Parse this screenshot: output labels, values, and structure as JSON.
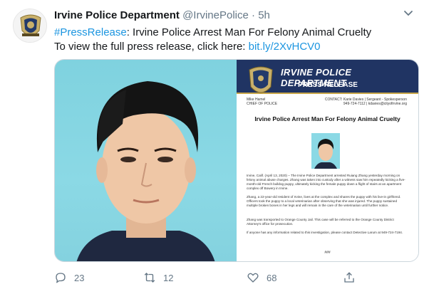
{
  "tweet": {
    "author_name": "Irvine Police Department",
    "author_handle": "@IrvinePolice",
    "separator": "·",
    "time": "5h",
    "hashtag": "#PressRelease",
    "headline": ": Irvine Police Arrest Man For Felony Animal Cruelty",
    "line2": "To view the full press release, click here: ",
    "link": "bit.ly/2XvHCV0"
  },
  "press_release": {
    "banner_title": "IRVINE POLICE DEPARTMENT",
    "banner_subtitle": "PRESS RELEASE",
    "chief_name": "Mike Hamel",
    "chief_title": "CHIEF OF POLICE",
    "contact_line1": "CONTACT: Karie Davies | Sergeant - Spokesperson",
    "contact_line2": "949-724-7112 | kdavies@cityofirvine.org",
    "headline": "Irvine Police Arrest Man For Felony Animal Cruelty",
    "para1": "Irvine, Calif. (April 13, 2020) – The Irvine Police Department arrested Ruiang Zhang yesterday morning on felony animal abuse charges. Zhang was taken into custody after a witness saw him repeatedly kicking a five-month-old French bulldog puppy, ultimately kicking the female puppy down a flight of stairs at an apartment complex off Bowery in Irvine.",
    "para2": "Zhang, a 22-year-old resident of Irvine, lives at the complex and shares the puppy with his live-in girlfriend. Officers took the puppy to a local veterinarian after observing that she was injured. The puppy sustained multiple broken bones in her legs and will remain in the care of the veterinarian until further notice.",
    "para3": "Zhang was transported to Orange County Jail. This case will be referred to the Orange County District Attorney's office for prosecution.",
    "para4": "If anyone has any information related to this investigation, please contact Detective Larum at 949-724-7194.",
    "end_mark": "###"
  },
  "actions": {
    "reply_count": "23",
    "retweet_count": "12",
    "like_count": "68"
  },
  "icons": [
    "avatar-badge-icon",
    "caret-down-icon",
    "reply-icon",
    "retweet-icon",
    "like-icon",
    "share-icon"
  ],
  "colors": {
    "link": "#1b95e0",
    "muted": "#657786",
    "banner": "#203463"
  }
}
